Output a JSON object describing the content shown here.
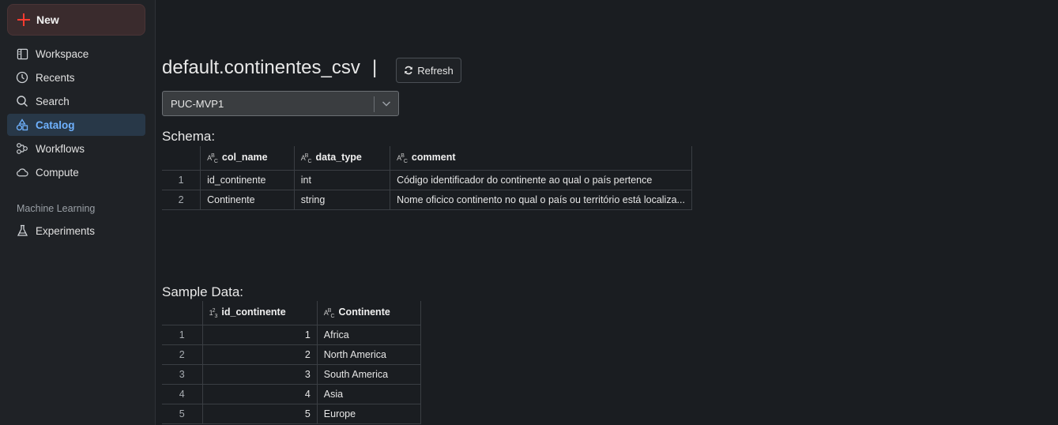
{
  "sidebar": {
    "new_label": "New",
    "items": [
      {
        "label": "Workspace",
        "icon": "workspace-icon"
      },
      {
        "label": "Recents",
        "icon": "clock-icon"
      },
      {
        "label": "Search",
        "icon": "search-icon"
      },
      {
        "label": "Catalog",
        "icon": "catalog-icon",
        "active": true
      },
      {
        "label": "Workflows",
        "icon": "workflows-icon"
      },
      {
        "label": "Compute",
        "icon": "cloud-icon"
      }
    ],
    "section_ml": "Machine Learning",
    "ml_items": [
      {
        "label": "Experiments",
        "icon": "flask-icon"
      }
    ]
  },
  "main": {
    "title": "default.continentes_csv",
    "title_separator": "|",
    "refresh_label": "Refresh",
    "select_value": "PUC-MVP1",
    "schema_heading": "Schema:",
    "schema": {
      "columns": [
        "col_name",
        "data_type",
        "comment"
      ],
      "rows": [
        {
          "idx": "1",
          "col_name": "id_continente",
          "data_type": "int",
          "comment": "Código identificador do continente ao qual o país pertence"
        },
        {
          "idx": "2",
          "col_name": "Continente",
          "data_type": "string",
          "comment": "Nome oficico continento no qual o país ou território está localiza..."
        }
      ]
    },
    "sample_heading": "Sample Data:",
    "sample": {
      "columns": [
        "id_continente",
        "Continente"
      ],
      "rows": [
        {
          "idx": "1",
          "id": "1",
          "name": "Africa"
        },
        {
          "idx": "2",
          "id": "2",
          "name": "North America"
        },
        {
          "idx": "3",
          "id": "3",
          "name": "South America"
        },
        {
          "idx": "4",
          "id": "4",
          "name": "Asia"
        },
        {
          "idx": "5",
          "id": "5",
          "name": "Europe"
        }
      ]
    }
  },
  "colors": {
    "accent": "#6fb2ff",
    "new_plus": "#ff3b30",
    "background": "#1a1d21"
  }
}
